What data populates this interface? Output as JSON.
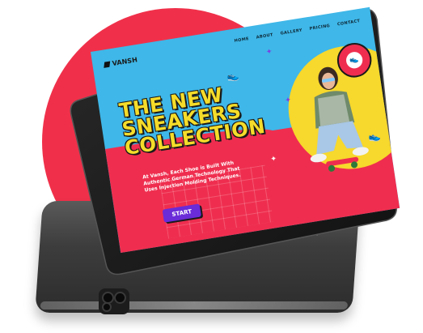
{
  "site": {
    "brand": "VANSH",
    "nav": [
      "HOME",
      "ABOUT",
      "GALLERY",
      "PRICING",
      "CONTACT"
    ],
    "headline_lines": [
      "THE NEW",
      "SNEAKERS",
      "COLLECTION"
    ],
    "description": "At Vansh, Each Shoe is Built With Authentic German Technology That Uses Injection Molding Techniques.",
    "cta_label": "START"
  },
  "colors": {
    "backdrop_circle": "#f0304a",
    "screen_blue": "#3fb7e8",
    "screen_red": "#ef2e4f",
    "headline_yellow": "#f5dc2a",
    "cta_purple": "#6a2bd8",
    "blob_yellow": "#f7d82c"
  }
}
